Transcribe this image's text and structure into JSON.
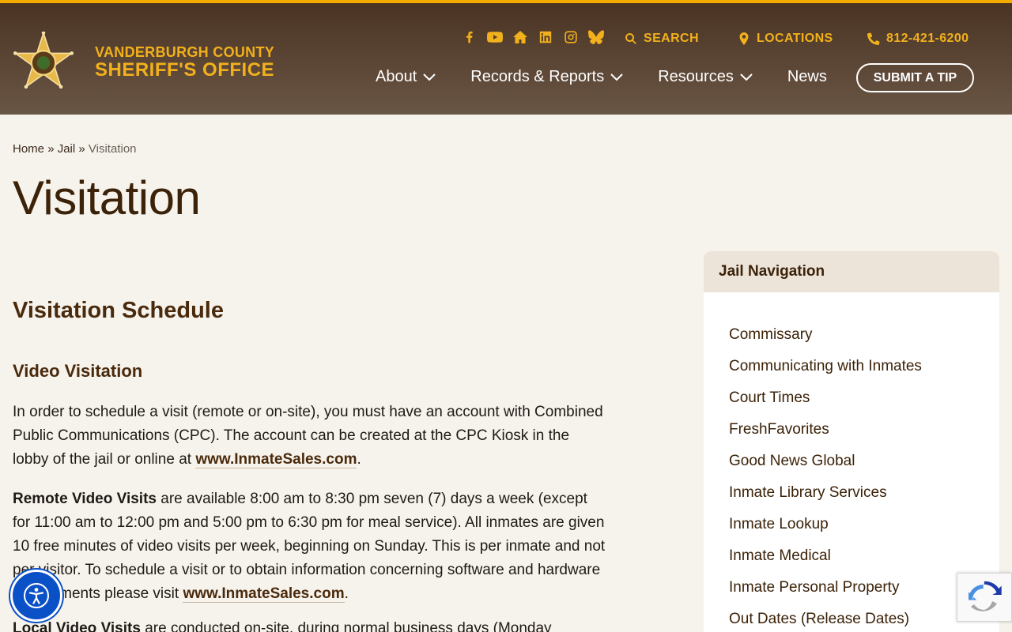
{
  "colors": {
    "accent": "#f2b11c",
    "header_dark": "#4a3322",
    "heading": "#4a2a0c",
    "page_bg": "#f6f2ec"
  },
  "brand": {
    "line1": "VANDERBURGH COUNTY",
    "line2": "SHERIFF'S OFFICE",
    "logo_icon": "sheriff-star-badge"
  },
  "social_icons": [
    "facebook-icon",
    "youtube-icon",
    "home-icon",
    "linkedin-icon",
    "instagram-icon",
    "bluesky-icon"
  ],
  "utility": {
    "search": "SEARCH",
    "locations": "LOCATIONS",
    "phone": "812-421-6200"
  },
  "nav": {
    "about": "About",
    "records": "Records & Reports",
    "resources": "Resources",
    "news": "News",
    "tip": "SUBMIT A TIP"
  },
  "breadcrumb": {
    "home": "Home",
    "sep": "»",
    "jail": "Jail",
    "current": "Visitation"
  },
  "page_title": "Visitation",
  "content": {
    "h2": "Visitation Schedule",
    "h3": "Video Visitation",
    "p1_text": "In order to schedule a visit (remote or on-site), you must have an account with Combined Public Communications (CPC). The account can be created at the CPC Kiosk in the lobby of the jail or online at ",
    "p1_link": "www.InmateSales.com",
    "p1_end": ".",
    "p2_bold": "Remote Video Visits",
    "p2_text": " are available 8:00 am to 8:30 pm seven (7) days a week (except for 11:00 am to 12:00 pm and 5:00 pm to 6:30 pm for meal service). All inmates are given 10 free minutes of video visits per week, beginning on Sunday. This is per inmate and not per visitor. To schedule a visit or to obtain information concerning software and hardware requirements please visit ",
    "p2_link": "www.InmateSales.com",
    "p2_end": ".",
    "p3_bold": "Local Video Visits",
    "p3_text": " are conducted on-site, during normal business days (Monday"
  },
  "sidebar": {
    "title": "Jail Navigation",
    "items": [
      "Commissary",
      "Communicating with Inmates",
      "Court Times",
      "FreshFavorites",
      "Good News Global",
      "Inmate Library Services",
      "Inmate Lookup",
      "Inmate Medical",
      "Inmate Personal Property",
      "Out Dates (Release Dates)"
    ]
  }
}
